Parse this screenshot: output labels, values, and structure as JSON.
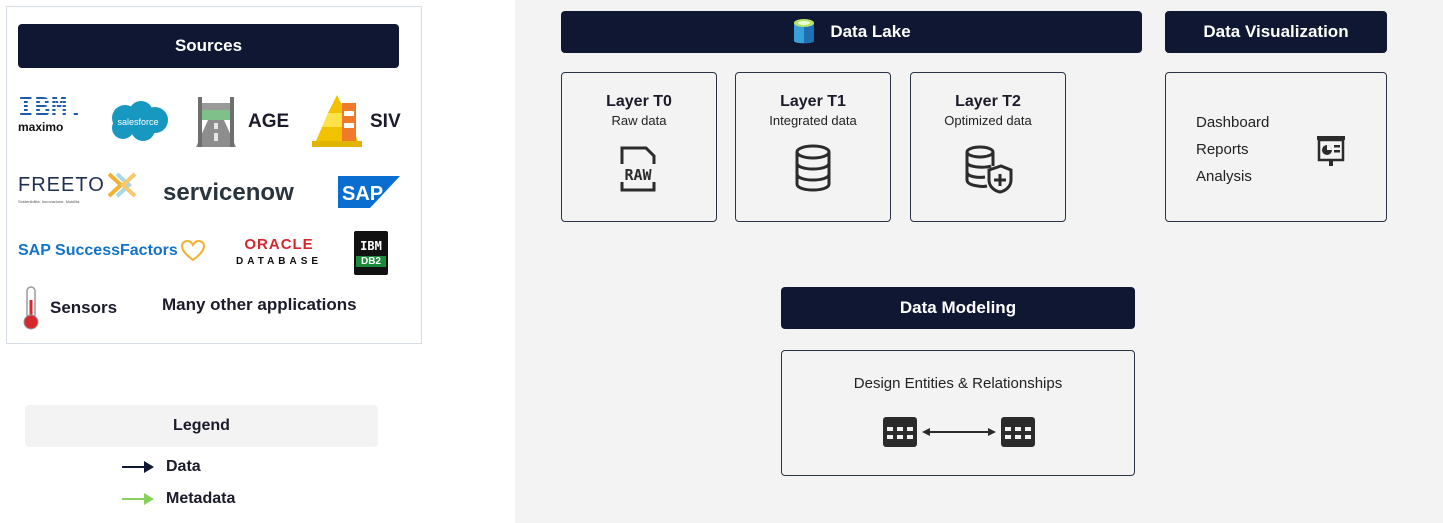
{
  "sources": {
    "title": "Sources",
    "logos": {
      "ibm": "IBM.",
      "maximo": "maximo",
      "salesforce": "salesforce",
      "age": "AGE",
      "siv": "SIV",
      "freeto": "FREETO",
      "freeto_tagline": "Sostenibilità. Innovazione. Mobilità",
      "servicenow": "servicenow",
      "sap": "SAP",
      "successfactors": "SAP SuccessFactors",
      "oracle": "ORACLE",
      "oracle_database": "DATABASE",
      "db2_ibm": "IBM",
      "db2": "DB2",
      "sensors": "Sensors",
      "many_other": "Many other applications"
    }
  },
  "legend": {
    "title": "Legend",
    "items": [
      {
        "label": "Data",
        "color": "#0f1733"
      },
      {
        "label": "Metadata",
        "color": "#86d25a"
      }
    ]
  },
  "data_lake": {
    "title": "Data Lake",
    "layers": [
      {
        "title": "Layer T0",
        "subtitle": "Raw data",
        "icon": "raw-file-icon"
      },
      {
        "title": "Layer T1",
        "subtitle": "Integrated data",
        "icon": "database-icon"
      },
      {
        "title": "Layer T2",
        "subtitle": "Optimized data",
        "icon": "database-shield-icon"
      }
    ]
  },
  "data_visualization": {
    "title": "Data Visualization",
    "items": [
      "Dashboard",
      "Reports",
      "Analysis"
    ],
    "icon": "presentation-chart-icon"
  },
  "data_modeling": {
    "title": "Data Modeling",
    "description": "Design Entities & Relationships",
    "icon": "entity-relationship-icon"
  },
  "colors": {
    "header_bg": "#0f1733",
    "panel_bg": "#f3f3f3",
    "metadata_green": "#86d25a",
    "ibm_blue": "#1f5ba9",
    "salesforce_blue": "#1798c1",
    "sap_blue": "#0a6ed1",
    "oracle_red": "#d7282f"
  }
}
